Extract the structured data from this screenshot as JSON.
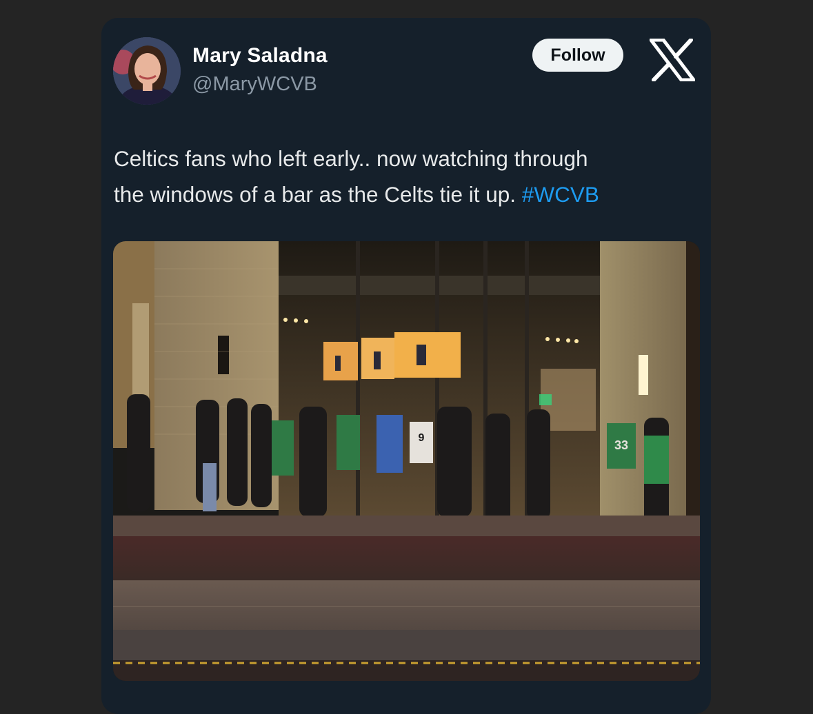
{
  "author": {
    "name": "Mary Saladna",
    "handle": "@MaryWCVB"
  },
  "follow_button": {
    "label": "Follow"
  },
  "brand": {
    "logo_icon": "x-logo-icon"
  },
  "tweet": {
    "text_line1": "Celtics fans who left early.. now watching through",
    "text_line2": "the windows of a bar as the Celts tie it up.",
    "hashtag": "#WCVB"
  },
  "photo": {
    "jersey_number_front": "9",
    "jersey_number_right": "33"
  },
  "colors": {
    "background": "#242424",
    "card": "#15202b",
    "hashtag": "#1d9bf0",
    "primary_text": "#e7e9ea",
    "secondary_text": "#8b98a5"
  }
}
